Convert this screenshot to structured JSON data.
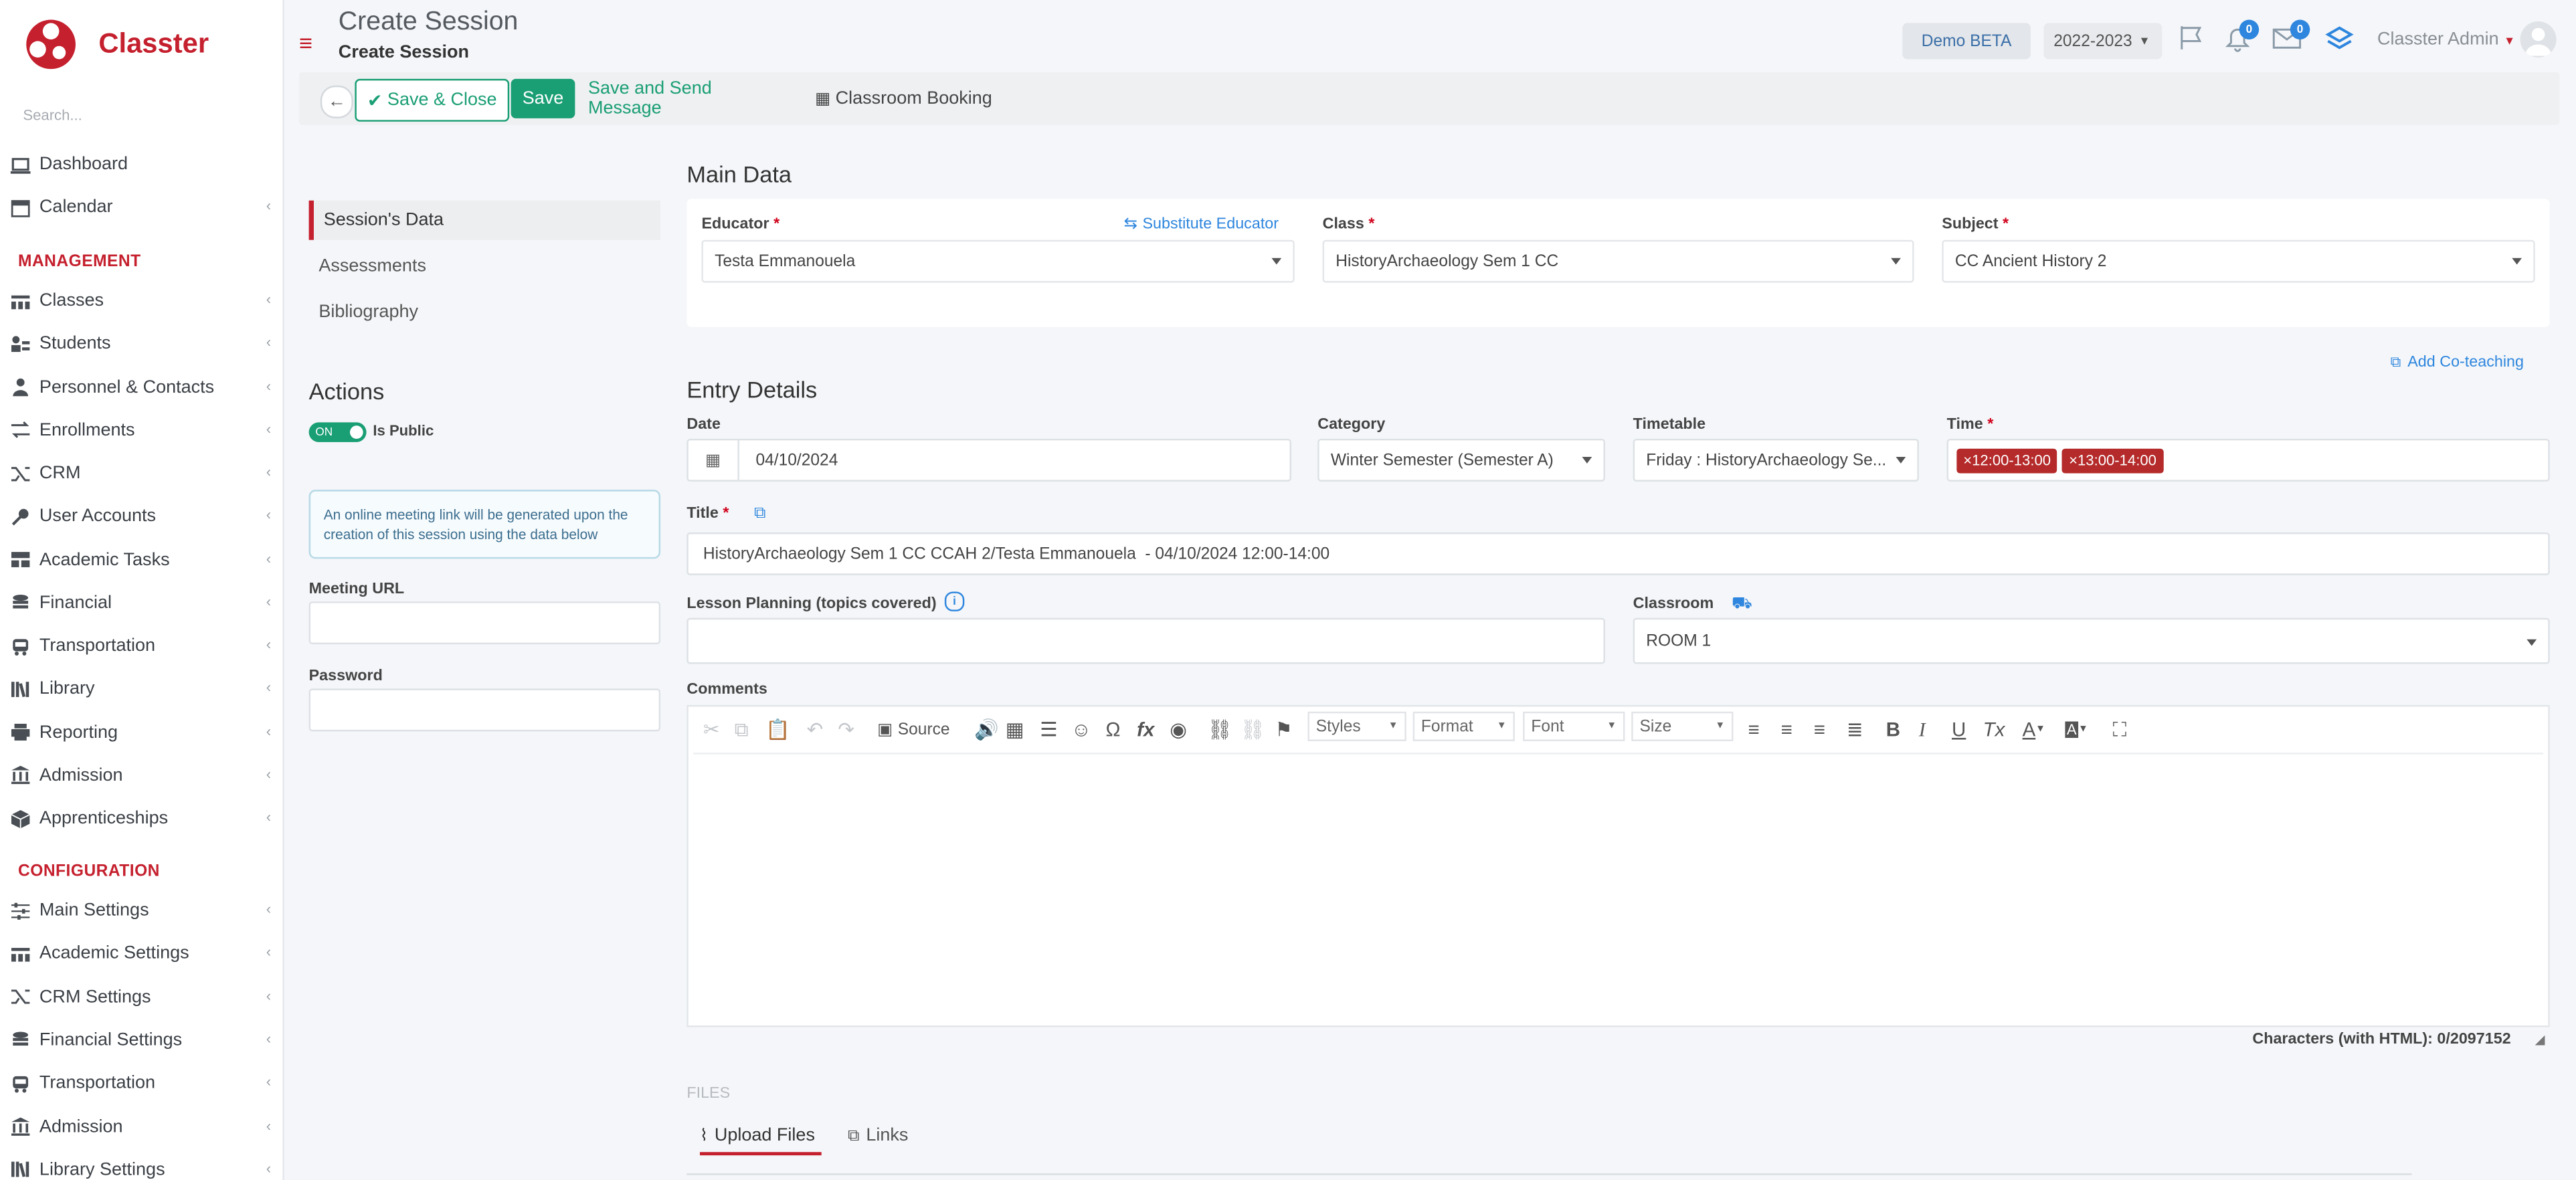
{
  "app": {
    "name": "Classter",
    "search_placeholder": "Search..."
  },
  "sidebar": {
    "items": [
      {
        "label": "Dashboard",
        "icon": "laptop-icon",
        "chevron": false
      },
      {
        "label": "Calendar",
        "icon": "calendar-icon",
        "chevron": true
      }
    ],
    "management_heading": "MANAGEMENT",
    "management": [
      {
        "label": "Classes",
        "icon": "classes-icon"
      },
      {
        "label": "Students",
        "icon": "students-icon"
      },
      {
        "label": "Personnel & Contacts",
        "icon": "personnel-icon"
      },
      {
        "label": "Enrollments",
        "icon": "enrollments-icon"
      },
      {
        "label": "CRM",
        "icon": "crm-icon"
      },
      {
        "label": "User Accounts",
        "icon": "key-icon"
      },
      {
        "label": "Academic Tasks",
        "icon": "tasks-icon"
      },
      {
        "label": "Financial",
        "icon": "coins-icon"
      },
      {
        "label": "Transportation",
        "icon": "bus-icon"
      },
      {
        "label": "Library",
        "icon": "books-icon"
      },
      {
        "label": "Reporting",
        "icon": "printer-icon"
      },
      {
        "label": "Admission",
        "icon": "building-icon"
      },
      {
        "label": "Apprenticeships",
        "icon": "box-icon"
      }
    ],
    "configuration_heading": "CONFIGURATION",
    "configuration": [
      {
        "label": "Main Settings",
        "icon": "sliders-icon"
      },
      {
        "label": "Academic Settings",
        "icon": "classes-icon"
      },
      {
        "label": "CRM Settings",
        "icon": "crm-icon"
      },
      {
        "label": "Financial Settings",
        "icon": "coins-icon"
      },
      {
        "label": "Transportation",
        "icon": "bus-icon"
      },
      {
        "label": "Admission",
        "icon": "building-icon"
      },
      {
        "label": "Library Settings",
        "icon": "books-icon"
      }
    ]
  },
  "header": {
    "title": "Create Session",
    "subtitle": "Create Session",
    "env_label": "Demo BETA",
    "year_label": "2022-2023",
    "notifications_count": "0",
    "messages_count": "0",
    "user_label": "Classter Admin"
  },
  "toolbar": {
    "save_close_label": "Save & Close",
    "save_label": "Save",
    "save_send_label": "Save and Send Message",
    "booking_label": "Classroom Booking"
  },
  "left_menu": {
    "items": [
      "Session's Data",
      "Assessments",
      "Bibliography"
    ],
    "actions_title": "Actions",
    "toggle_state": "ON",
    "toggle_label": "Is Public",
    "info_text": "An online meeting link will be generated upon the creation of this session using the data below",
    "meeting_url_label": "Meeting URL",
    "password_label": "Password"
  },
  "main_data": {
    "title": "Main Data",
    "educator_label": "Educator",
    "substitute_link": "Substitute Educator",
    "educator_value": "Testa Emmanouela",
    "class_label": "Class",
    "class_value": "HistoryArchaeology Sem 1 CC",
    "subject_label": "Subject",
    "subject_value": "CC Ancient History 2",
    "add_coteaching": "Add Co-teaching"
  },
  "entry": {
    "title": "Entry Details",
    "date_label": "Date",
    "date_value": "04/10/2024",
    "category_label": "Category",
    "category_value": "Winter Semester (Semester A)",
    "timetable_label": "Timetable",
    "timetable_value": "Friday : HistoryArchaeology Se...",
    "time_label": "Time",
    "time_tags": [
      "×12:00-13:00",
      "×13:00-14:00"
    ],
    "title_label": "Title",
    "title_value": "HistoryArchaeology Sem 1 CC CCAH 2/Testa Emmanouela  - 04/10/2024 12:00-14:00",
    "lesson_label": "Lesson Planning (topics covered)",
    "classroom_label": "Classroom",
    "classroom_value": "ROOM 1",
    "comments_label": "Comments"
  },
  "editor": {
    "source_label": "Source",
    "styles_label": "Styles",
    "format_label": "Format",
    "font_label": "Font",
    "size_label": "Size",
    "char_count": "Characters (with HTML): 0/2097152"
  },
  "files": {
    "heading": "FILES",
    "upload_tab": "Upload Files",
    "links_tab": "Links"
  },
  "colors": {
    "brand_red": "#c5202e",
    "green": "#1a9e74",
    "tag_red": "#b52a2a",
    "link_blue": "#2e86de"
  }
}
